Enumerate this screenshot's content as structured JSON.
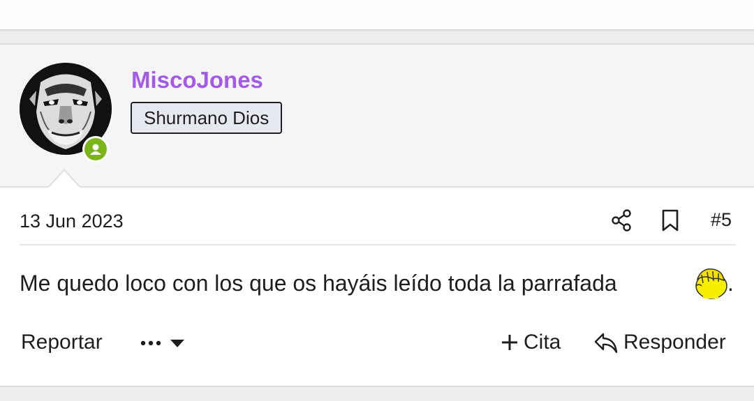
{
  "post": {
    "username": "MiscoJones",
    "user_title": "Shurmano Dios",
    "date": "13 Jun 2023",
    "post_number": "#5",
    "message": "Me quedo loco con los que os hayáis leído toda la parrafada",
    "message_end": ".",
    "emoji": "facepalm-emoji"
  },
  "actions": {
    "report": "Reportar",
    "quote": "Cita",
    "reply": "Responder"
  },
  "colors": {
    "username": "#a35ae8",
    "online": "#7cb518",
    "badge_bg": "#e6e9ef"
  },
  "icons": [
    "share-icon",
    "bookmark-icon",
    "more-icon",
    "plus-icon",
    "reply-icon"
  ]
}
